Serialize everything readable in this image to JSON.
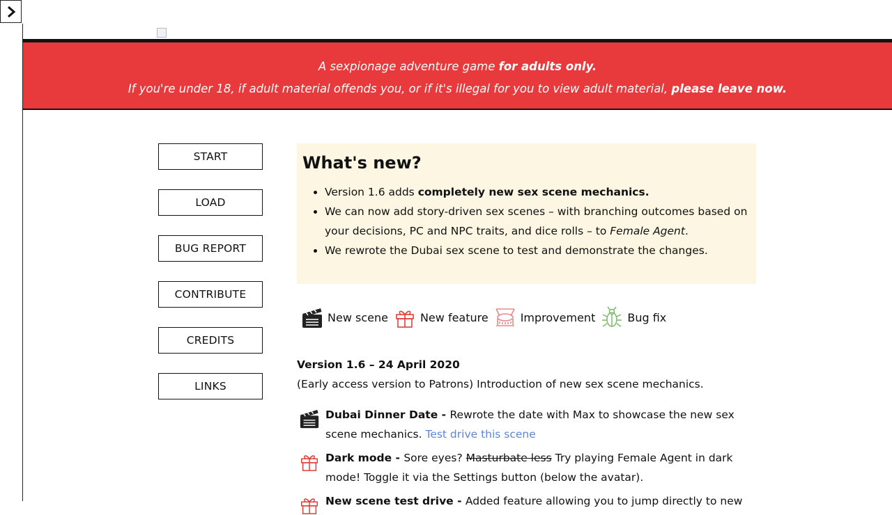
{
  "sidebar_toggle": {
    "icon": "chevron-right-icon"
  },
  "banner": {
    "line1_prefix": "A sexpionage adventure game ",
    "line1_bold": "for adults only.",
    "line2_prefix": "If you're under 18, if adult material offends you, or if it's illegal for you to view adult material, ",
    "line2_bold": "please leave now."
  },
  "nav": [
    "START",
    "LOAD",
    "BUG REPORT",
    "CONTRIBUTE",
    "CREDITS",
    "LINKS"
  ],
  "whats_new": {
    "title": "What's new?",
    "item1_prefix": "Version 1.6 adds ",
    "item1_bold": "completely new sex scene mechanics.",
    "item2_prefix": "We can now add story-driven sex scenes – with branching outcomes based on your decisions, PC and NPC traits, and dice rolls – to ",
    "item2_italic": "Female Agent",
    "item2_suffix": ".",
    "item3": "We rewrote the Dubai sex scene to test and demonstrate the changes."
  },
  "legend": {
    "new_scene": "New scene",
    "new_feature": "New feature",
    "improvement": "Improvement",
    "bug_fix": "Bug fix"
  },
  "changelog": {
    "version_title": "Version 1.6 – 24 April 2020",
    "version_desc": "(Early access version to Patrons) Introduction of new sex scene mechanics.",
    "entries": [
      {
        "title": "Dubai Dinner Date - ",
        "text": "Rewrote the date with Max to showcase the new sex scene mechanics. ",
        "link": "Test drive this scene"
      },
      {
        "title": "Dark mode - ",
        "text_before": "Sore eyes? ",
        "strike": "Masturbate less",
        "text_after": " Try playing Female Agent in dark mode! Toggle it via the Settings button (below the avatar)."
      },
      {
        "title": "New scene test drive - ",
        "text": "Added feature allowing you to jump directly to new"
      }
    ]
  },
  "colors": {
    "banner_bg": "#e8393c",
    "whats_new_bg": "#fcf6e3",
    "link": "#5b87d6",
    "feature_icon": "#e0403a",
    "improvement_icon": "#e8898a",
    "bug_icon": "#7cb86b"
  }
}
